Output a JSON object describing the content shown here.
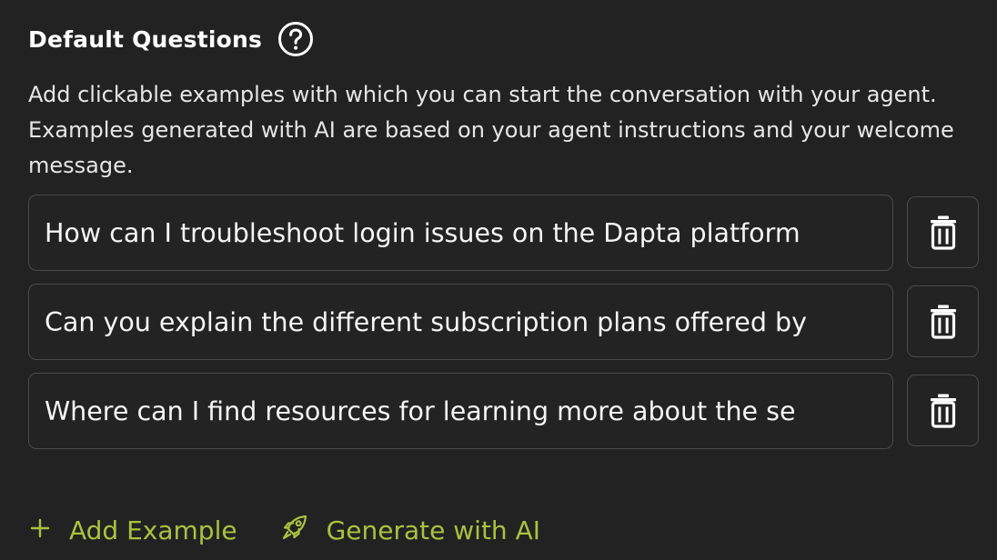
{
  "section": {
    "title": "Default Questions",
    "help_icon": "question-circle-icon",
    "description": "Add clickable examples with which you can start the conversation with your agent. Examples generated with AI are based on your agent instructions and your welcome message."
  },
  "questions": [
    {
      "value": "How can I troubleshoot login issues on the Dapta platform",
      "delete_icon": "trash-icon"
    },
    {
      "value": "Can you explain the different subscription plans offered by",
      "delete_icon": "trash-icon"
    },
    {
      "value": "Where can I find resources for learning more about the se",
      "delete_icon": "trash-icon"
    }
  ],
  "actions": {
    "add_label": "Add Example",
    "add_icon": "plus-icon",
    "generate_label": "Generate with AI",
    "generate_icon": "rocket-icon"
  },
  "colors": {
    "background": "#222222",
    "accent": "#a8c23f",
    "border": "#4a4a4a",
    "text": "#f2f2f2"
  }
}
